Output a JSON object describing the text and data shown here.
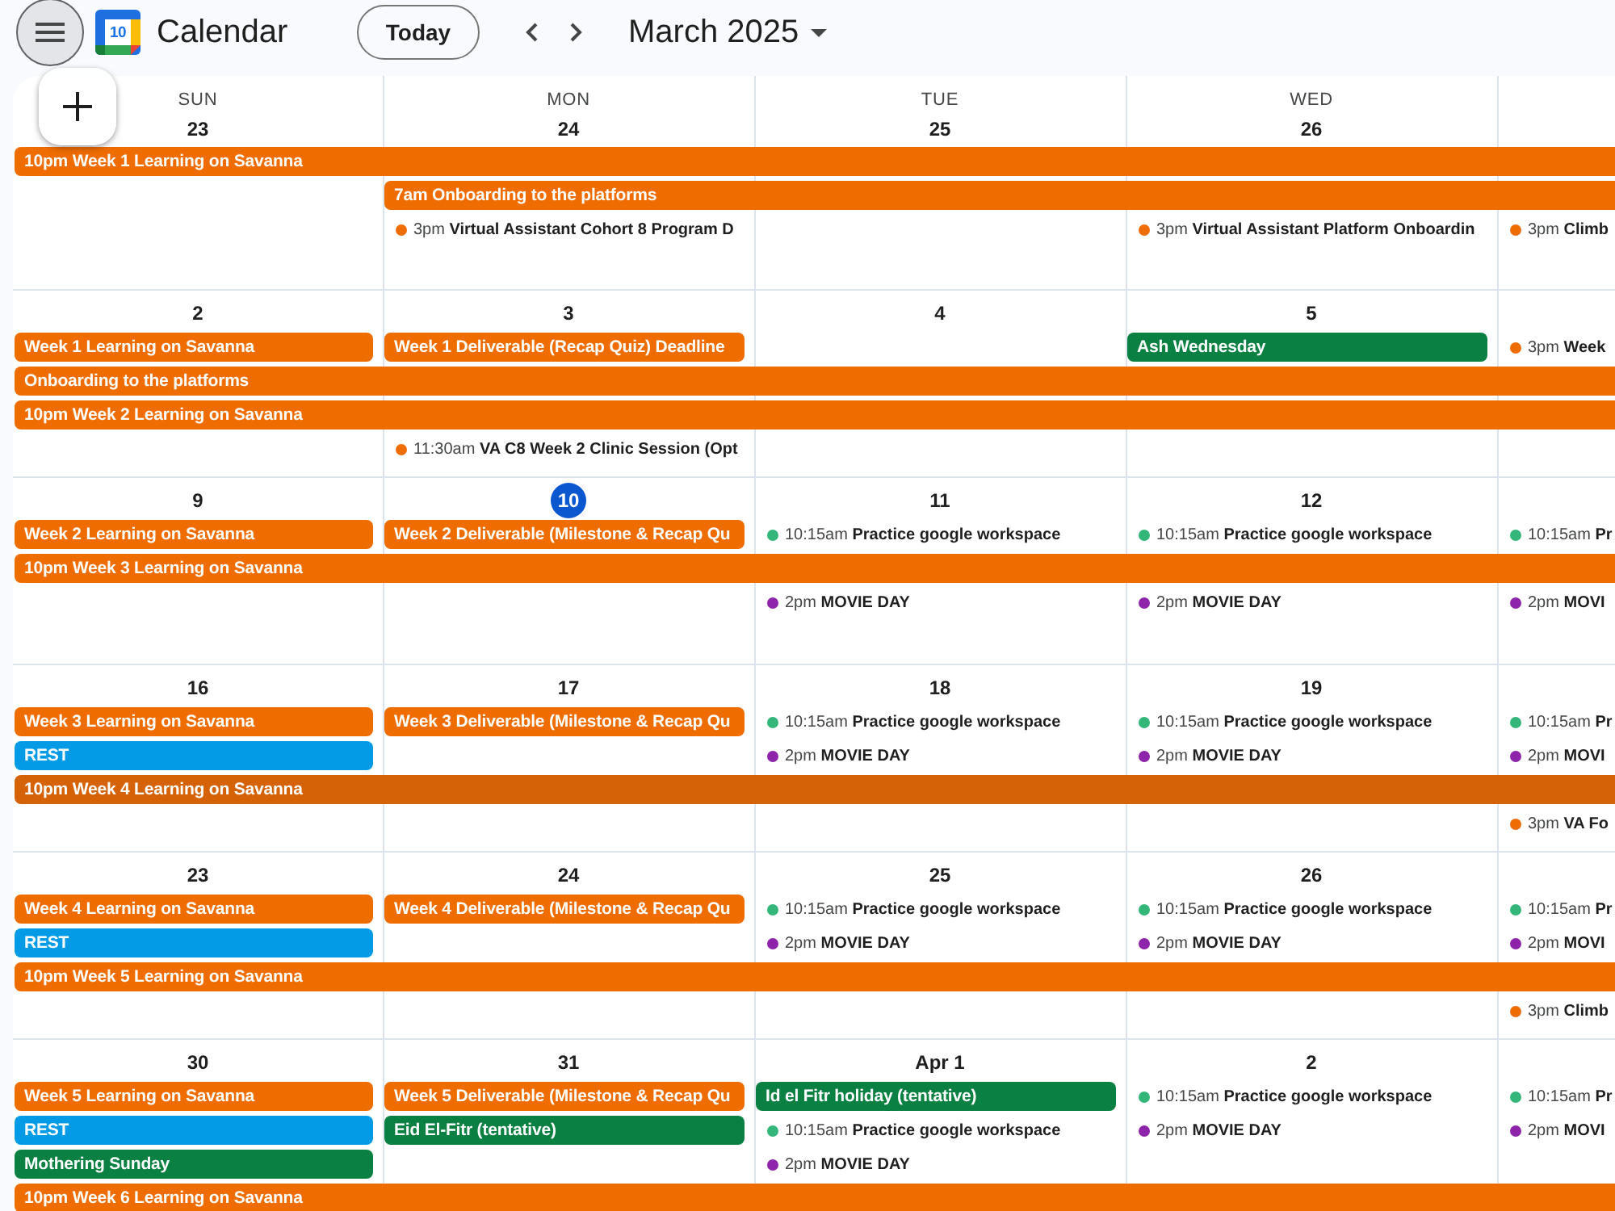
{
  "header": {
    "app_name": "Calendar",
    "logo_date": "10",
    "today_button": "Today",
    "month": "March 2025"
  },
  "weeks": [
    {
      "days": [
        {
          "weekday": "SUN",
          "date": "23",
          "today": false,
          "items": [
            {
              "kind": "chip",
              "title": "10pm Week 1 Learning on Savanna",
              "color": "#ef6c00",
              "continues": true
            }
          ]
        },
        {
          "weekday": "MON",
          "date": "24",
          "today": false,
          "items": [
            {
              "kind": "chip",
              "title": "7am Onboarding to the platforms",
              "color": "#ef6c00",
              "continues": true
            },
            {
              "kind": "timed",
              "time": "3pm",
              "title": "Virtual Assistant Cohort 8 Program D",
              "color": "#ef6c00"
            }
          ]
        },
        {
          "weekday": "TUE",
          "date": "25",
          "today": false
        },
        {
          "weekday": "WED",
          "date": "26",
          "today": false,
          "items": [
            {
              "kind": "timed",
              "time": "3pm",
              "title": "Virtual Assistant Platform Onboardin",
              "color": "#ef6c00"
            }
          ]
        },
        {
          "items": [
            {
              "kind": "timed",
              "time": "3pm",
              "title": "Climb",
              "color": "#ef6c00"
            }
          ]
        }
      ]
    },
    {
      "days": [
        {
          "date": "2",
          "today": false,
          "items": [
            {
              "kind": "chip",
              "title": "Week 1 Learning on Savanna",
              "color": "#ef6c00",
              "continues": false
            },
            {
              "kind": "chip",
              "title": "Onboarding to the platforms",
              "color": "#ef6c00",
              "continues": true
            },
            {
              "kind": "chip",
              "title": "10pm Week 2 Learning on Savanna",
              "color": "#ef6c00",
              "continues": true
            }
          ]
        },
        {
          "date": "3",
          "today": false,
          "items": [
            {
              "kind": "chip",
              "title": "Week 1 Deliverable (Recap Quiz) Deadline",
              "color": "#ef6c00",
              "continues": false
            },
            {
              "kind": "timed",
              "time": "11:30am",
              "title": "VA C8 Week 2 Clinic Session (Opt",
              "color": "#ef6c00"
            }
          ]
        },
        {
          "date": "4",
          "today": false
        },
        {
          "date": "5",
          "today": false,
          "items": [
            {
              "kind": "chip",
              "title": "Ash Wednesday",
              "color": "#0b8043",
              "continues": false
            }
          ]
        },
        {
          "items": [
            {
              "kind": "timed",
              "time": "3pm",
              "title": "Week",
              "color": "#ef6c00"
            }
          ]
        }
      ]
    },
    {
      "days": [
        {
          "date": "9",
          "today": false,
          "items": [
            {
              "kind": "chip",
              "title": "Week 2 Learning on Savanna",
              "color": "#ef6c00",
              "continues": false
            },
            {
              "kind": "chip",
              "title": "10pm Week 3 Learning on Savanna",
              "color": "#ef6c00",
              "continues": true
            }
          ]
        },
        {
          "date": "10",
          "today": true,
          "items": [
            {
              "kind": "chip",
              "title": "Week 2 Deliverable (Milestone & Recap Qu",
              "color": "#ef6c00",
              "continues": false
            }
          ]
        },
        {
          "date": "11",
          "today": false,
          "items": [
            {
              "kind": "timed",
              "time": "10:15am",
              "title": "Practice google workspace",
              "color": "#33b679"
            },
            {
              "kind": "timed",
              "time": "2pm",
              "title": "MOVIE DAY",
              "color": "#8e24aa"
            }
          ]
        },
        {
          "date": "12",
          "today": false,
          "items": [
            {
              "kind": "timed",
              "time": "10:15am",
              "title": "Practice google workspace",
              "color": "#33b679"
            },
            {
              "kind": "timed",
              "time": "2pm",
              "title": "MOVIE DAY",
              "color": "#8e24aa"
            }
          ]
        },
        {
          "items": [
            {
              "kind": "timed",
              "time": "10:15am",
              "title": "Pr",
              "color": "#33b679"
            },
            {
              "kind": "timed",
              "time": "2pm",
              "title": "MOVI",
              "color": "#8e24aa"
            }
          ]
        }
      ]
    },
    {
      "days": [
        {
          "date": "16",
          "today": false,
          "items": [
            {
              "kind": "chip",
              "title": "Week 3 Learning on Savanna",
              "color": "#ef6c00",
              "continues": false
            },
            {
              "kind": "chip",
              "title": "REST",
              "color": "#039be5",
              "continues": false
            },
            {
              "kind": "chip",
              "title": "10pm Week 4 Learning on Savanna",
              "color": "#d56206",
              "continues": true
            }
          ]
        },
        {
          "date": "17",
          "today": false,
          "items": [
            {
              "kind": "chip",
              "title": "Week 3 Deliverable (Milestone & Recap Qu",
              "color": "#ef6c00",
              "continues": false
            }
          ]
        },
        {
          "date": "18",
          "today": false,
          "items": [
            {
              "kind": "timed",
              "time": "10:15am",
              "title": "Practice google workspace",
              "color": "#33b679"
            },
            {
              "kind": "timed",
              "time": "2pm",
              "title": "MOVIE DAY",
              "color": "#8e24aa"
            }
          ]
        },
        {
          "date": "19",
          "today": false,
          "items": [
            {
              "kind": "timed",
              "time": "10:15am",
              "title": "Practice google workspace",
              "color": "#33b679"
            },
            {
              "kind": "timed",
              "time": "2pm",
              "title": "MOVIE DAY",
              "color": "#8e24aa"
            }
          ]
        },
        {
          "items": [
            {
              "kind": "timed",
              "time": "10:15am",
              "title": "Pr",
              "color": "#33b679"
            },
            {
              "kind": "timed",
              "time": "2pm",
              "title": "MOVI",
              "color": "#8e24aa"
            },
            {
              "kind": "timed",
              "time": "3pm",
              "title": "VA Fo",
              "color": "#ef6c00"
            }
          ]
        }
      ]
    },
    {
      "days": [
        {
          "date": "23",
          "today": false,
          "items": [
            {
              "kind": "chip",
              "title": "Week 4 Learning on Savanna",
              "color": "#ef6c00",
              "continues": false
            },
            {
              "kind": "chip",
              "title": "REST",
              "color": "#039be5",
              "continues": false
            },
            {
              "kind": "chip",
              "title": "10pm Week 5 Learning on Savanna",
              "color": "#ef6c00",
              "continues": true
            }
          ]
        },
        {
          "date": "24",
          "today": false,
          "items": [
            {
              "kind": "chip",
              "title": "Week 4 Deliverable (Milestone & Recap Qu",
              "color": "#ef6c00",
              "continues": false
            }
          ]
        },
        {
          "date": "25",
          "today": false,
          "items": [
            {
              "kind": "timed",
              "time": "10:15am",
              "title": "Practice google workspace",
              "color": "#33b679"
            },
            {
              "kind": "timed",
              "time": "2pm",
              "title": "MOVIE DAY",
              "color": "#8e24aa"
            }
          ]
        },
        {
          "date": "26",
          "today": false,
          "items": [
            {
              "kind": "timed",
              "time": "10:15am",
              "title": "Practice google workspace",
              "color": "#33b679"
            },
            {
              "kind": "timed",
              "time": "2pm",
              "title": "MOVIE DAY",
              "color": "#8e24aa"
            }
          ]
        },
        {
          "items": [
            {
              "kind": "timed",
              "time": "10:15am",
              "title": "Pr",
              "color": "#33b679"
            },
            {
              "kind": "timed",
              "time": "2pm",
              "title": "MOVI",
              "color": "#8e24aa"
            },
            {
              "kind": "timed",
              "time": "3pm",
              "title": "Climb",
              "color": "#ef6c00"
            }
          ]
        }
      ]
    },
    {
      "days": [
        {
          "date": "30",
          "today": false,
          "items": [
            {
              "kind": "chip",
              "title": "Week 5 Learning on Savanna",
              "color": "#ef6c00",
              "continues": false
            },
            {
              "kind": "chip",
              "title": "REST",
              "color": "#039be5",
              "continues": false
            },
            {
              "kind": "chip",
              "title": "Mothering Sunday",
              "color": "#0b8043",
              "continues": false
            },
            {
              "kind": "chip",
              "title": "10pm Week 6 Learning on Savanna",
              "color": "#ef6c00",
              "continues": true
            }
          ]
        },
        {
          "date": "31",
          "today": false,
          "items": [
            {
              "kind": "chip",
              "title": "Week 5 Deliverable (Milestone & Recap Qu",
              "color": "#ef6c00",
              "continues": false
            },
            {
              "kind": "chip",
              "title": "Eid El-Fitr (tentative)",
              "color": "#0b8043",
              "continues": false
            }
          ]
        },
        {
          "date": "Apr 1",
          "today": false,
          "items": [
            {
              "kind": "chip",
              "title": "Id el Fitr holiday (tentative)",
              "color": "#0b8043",
              "continues": false
            },
            {
              "kind": "timed",
              "time": "10:15am",
              "title": "Practice google workspace",
              "color": "#33b679"
            },
            {
              "kind": "timed",
              "time": "2pm",
              "title": "MOVIE DAY",
              "color": "#8e24aa"
            }
          ]
        },
        {
          "date": "2",
          "today": false,
          "items": [
            {
              "kind": "timed",
              "time": "10:15am",
              "title": "Practice google workspace",
              "color": "#33b679"
            },
            {
              "kind": "timed",
              "time": "2pm",
              "title": "MOVIE DAY",
              "color": "#8e24aa"
            }
          ]
        },
        {
          "items": [
            {
              "kind": "timed",
              "time": "10:15am",
              "title": "Pr",
              "color": "#33b679"
            },
            {
              "kind": "timed",
              "time": "2pm",
              "title": "MOVI",
              "color": "#8e24aa"
            }
          ]
        }
      ]
    }
  ]
}
